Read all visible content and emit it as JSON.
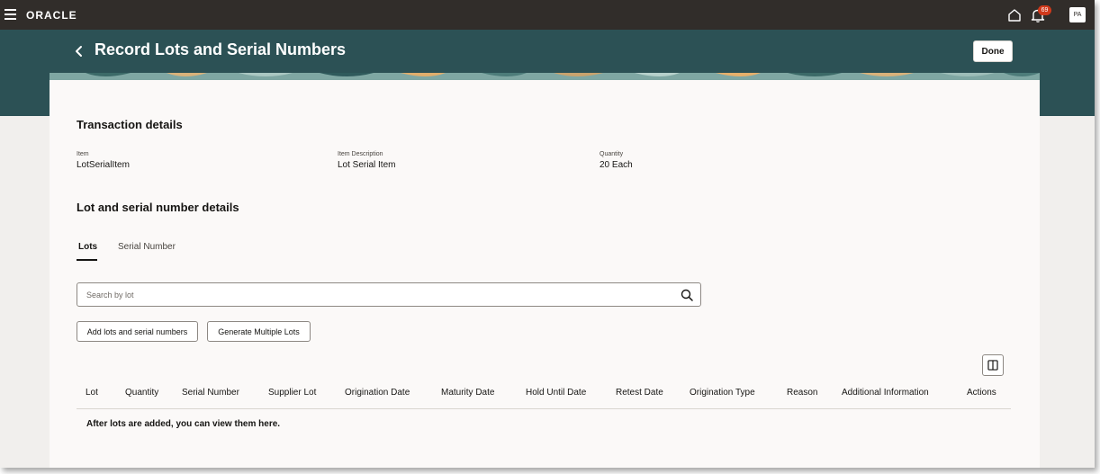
{
  "topbar": {
    "logo": "ORACLE",
    "notification_count": "69",
    "avatar_initials": "PA"
  },
  "header": {
    "title": "Record Lots and Serial Numbers",
    "done_label": "Done"
  },
  "transaction": {
    "section_title": "Transaction details",
    "fields": [
      {
        "label": "Item",
        "value": "LotSerialItem"
      },
      {
        "label": "Item Description",
        "value": "Lot Serial Item"
      },
      {
        "label": "Quantity",
        "value": "20 Each"
      }
    ]
  },
  "lot_details": {
    "section_title": "Lot and serial number details",
    "tabs": [
      {
        "label": "Lots",
        "active": true
      },
      {
        "label": "Serial Number",
        "active": false
      }
    ],
    "search_placeholder": "Search by lot",
    "buttons": {
      "add": "Add lots and serial numbers",
      "generate": "Generate Multiple Lots"
    },
    "columns": [
      "Lot",
      "Quantity",
      "Serial Number",
      "Supplier Lot",
      "Origination Date",
      "Maturity Date",
      "Hold Until Date",
      "Retest Date",
      "Origination Type",
      "Reason",
      "Additional Information",
      "Actions"
    ],
    "empty_message": "After lots are added, you can view them here."
  },
  "colors": {
    "topbar": "#312d2a",
    "band": "#2c5155",
    "card": "#fbf9f8",
    "badge": "#d0391b"
  }
}
